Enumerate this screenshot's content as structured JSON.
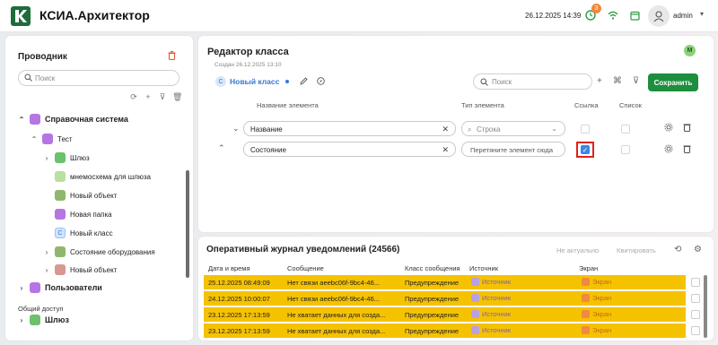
{
  "app": {
    "title": "КСИА.Архитектор",
    "datetime": "26.12.2025 14:39",
    "notification_count": "3",
    "user": "admin"
  },
  "explorer": {
    "title": "Проводник",
    "search_placeholder": "Поиск",
    "tree": [
      {
        "label": "Справочная система",
        "icon": "purple-folder-icon",
        "expanded": true
      },
      {
        "label": "Тест",
        "icon": "purple-folder-icon",
        "expanded": true
      },
      {
        "label": "Шлюз",
        "icon": "gateway-icon"
      },
      {
        "label": "мнемосхема для шлюза",
        "icon": "mnemo-icon"
      },
      {
        "label": "Новый объект",
        "icon": "object-icon"
      },
      {
        "label": "Новая папка",
        "icon": "purple-folder-icon"
      },
      {
        "label": "Новый класс",
        "icon": "class-icon"
      },
      {
        "label": "Состояние оборудования",
        "icon": "object-icon"
      },
      {
        "label": "Новый объект",
        "icon": "object-icon"
      },
      {
        "label": "Пользователи",
        "icon": "purple-folder-icon"
      },
      {
        "label": "Шлюз",
        "icon": "gateway-icon"
      }
    ],
    "section_label": "Общий доступ"
  },
  "editor": {
    "title": "Редактор класса",
    "created": "Создан 26.12.2025 13:10",
    "class_badge": "С",
    "class_name": "Новый класс",
    "search_placeholder": "Поиск",
    "save_label": "Сохранить",
    "avatar_letter": "M",
    "columns": {
      "name": "Название элемента",
      "type": "Тип элемента",
      "link": "Ссылка",
      "list": "Список"
    },
    "rows": [
      {
        "name": "Название",
        "type": "Строка",
        "link": false,
        "list": false
      },
      {
        "name": "Состояние",
        "type": "Перетяните элемент сюда",
        "link": true,
        "list": false
      }
    ]
  },
  "journal": {
    "title": "Оперативный журнал уведомлений (24566)",
    "btn_not_actual": "Не актуально",
    "btn_ack": "Квитировать",
    "columns": [
      "Дата и время",
      "Сообщение",
      "Класс сообщения",
      "Источник",
      "Экран"
    ],
    "rows": [
      {
        "datetime": "25.12.2025 08:49:09",
        "message": "Нет связи aeebc06f-9bc4-46...",
        "class": "Предупреждение",
        "source": "Источник",
        "screen": "Экран"
      },
      {
        "datetime": "24.12.2025 10:00:07",
        "message": "Нет связи aeebc06f-9bc4-46...",
        "class": "Предупреждение",
        "source": "Источник",
        "screen": "Экран"
      },
      {
        "datetime": "23.12.2025 17:13:59",
        "message": "Не хватает данных для созда...",
        "class": "Предупреждение",
        "source": "Источник",
        "screen": "Экран"
      },
      {
        "datetime": "23.12.2025 17:13:59",
        "message": "Не хватает данных для созда...",
        "class": "Предупреждение",
        "source": "Источник",
        "screen": "Экран"
      }
    ],
    "row_color": "#F5C200"
  },
  "colors": {
    "accent_green": "#1E8E3E",
    "link_blue": "#3477D8",
    "delete_red": "#E0562B"
  }
}
